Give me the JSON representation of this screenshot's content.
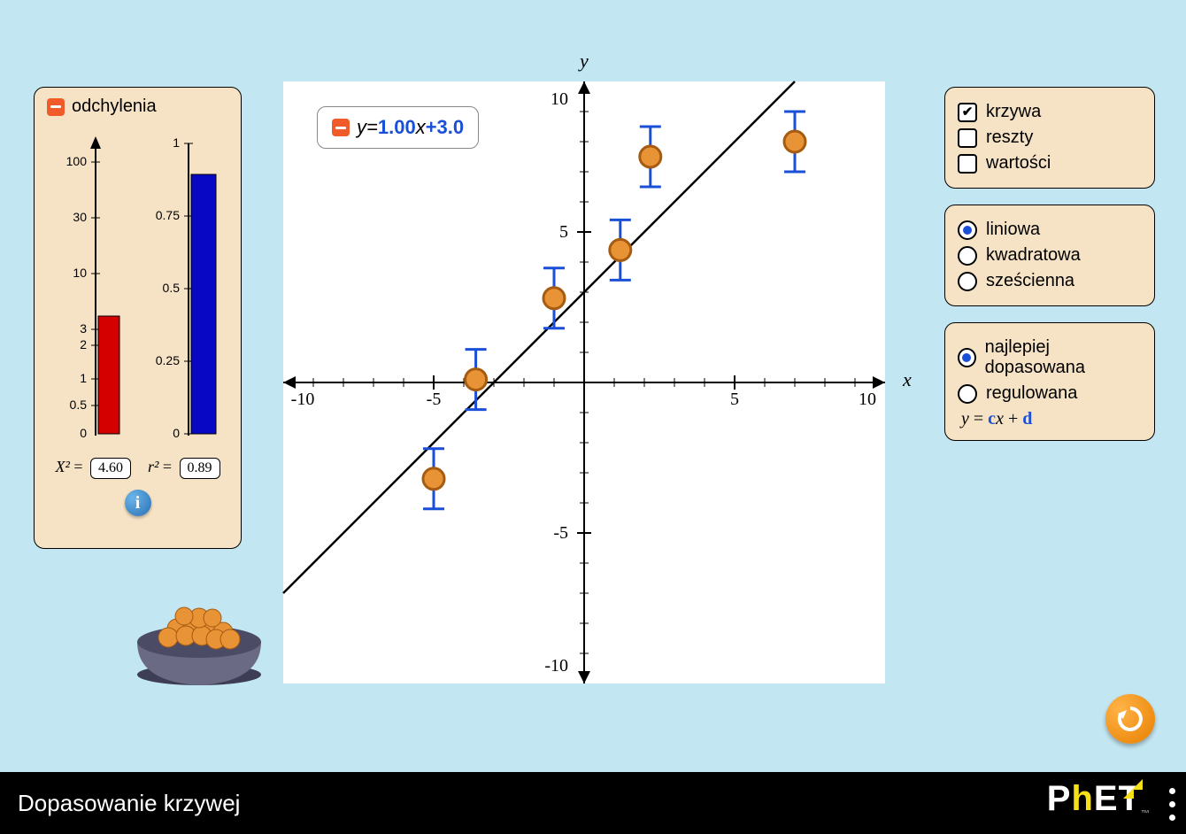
{
  "footer": {
    "title": "Dopasowanie krzywej",
    "brand": "PhET"
  },
  "deviations": {
    "title": "odchylenia",
    "chi2_label": "X²",
    "chi2_value": "4.60",
    "r2_label": "r²",
    "r2_value": "0.89",
    "chi_ticks": [
      "100",
      "30",
      "10",
      "3",
      "2",
      "1",
      "0.5",
      "0"
    ],
    "r_ticks": [
      "1",
      "0.75",
      "0.5",
      "0.25",
      "0"
    ]
  },
  "equation": {
    "lhs": "y",
    "eq": " = ",
    "a": "1.00",
    "x": "x",
    "plus": " + ",
    "b": "3.0"
  },
  "axes": {
    "x": "x",
    "y": "y",
    "x_ticks": [
      "-10",
      "-5",
      "5",
      "10",
      "10",
      "-10",
      "-5",
      "5"
    ]
  },
  "view": {
    "curve": "krzywa",
    "residuals": "reszty",
    "values": "wartości"
  },
  "fit_type": {
    "linear": "liniowa",
    "quadratic": "kwadratowa",
    "cubic": "sześcienna"
  },
  "fit_mode": {
    "best": "najlepiej dopasowana",
    "adjustable": "regulowana",
    "formula_lhs": "y",
    "formula_eq": " = ",
    "formula_c": "c",
    "formula_x": "x",
    "formula_plus": " + ",
    "formula_d": "d"
  },
  "chart_data": {
    "type": "scatter",
    "title": "",
    "xlabel": "x",
    "ylabel": "y",
    "xlim": [
      -10,
      10
    ],
    "ylim": [
      -10,
      10
    ],
    "series": [
      {
        "name": "data points",
        "points": [
          {
            "x": -5.0,
            "y": -3.2,
            "err": 1.0
          },
          {
            "x": -3.6,
            "y": 0.1,
            "err": 1.0
          },
          {
            "x": -1.0,
            "y": 2.8,
            "err": 1.0
          },
          {
            "x": 1.2,
            "y": 4.4,
            "err": 1.0
          },
          {
            "x": 2.2,
            "y": 7.5,
            "err": 1.0
          },
          {
            "x": 7.0,
            "y": 8.0,
            "err": 1.0
          }
        ]
      },
      {
        "name": "fit line",
        "type": "line",
        "equation": "y = 1.00 x + 3.0",
        "slope": 1.0,
        "intercept": 3.0
      }
    ],
    "stats": {
      "chi2": 4.6,
      "r2": 0.89
    }
  }
}
